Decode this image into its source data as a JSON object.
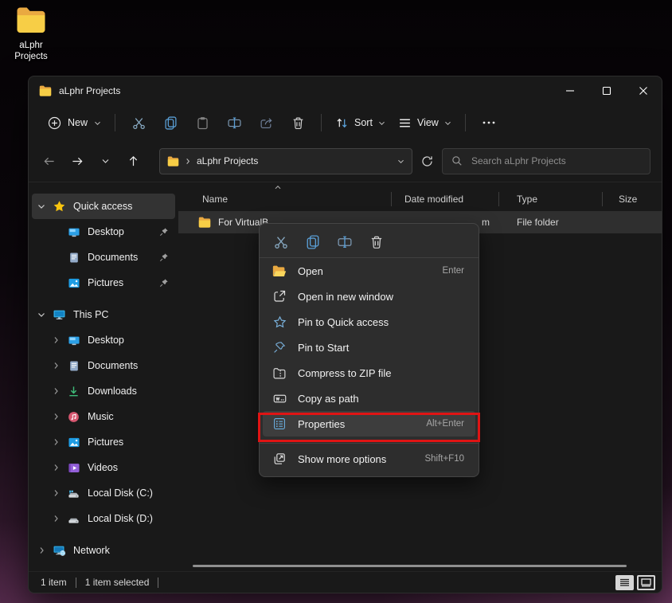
{
  "desktop_icon": {
    "label_line1": "aLphr",
    "label_line2": "Projects"
  },
  "window": {
    "title": "aLphr Projects"
  },
  "toolbar": {
    "new_label": "New",
    "sort_label": "Sort",
    "view_label": "View"
  },
  "address_bar": {
    "location": "aLphr Projects"
  },
  "search": {
    "placeholder": "Search aLphr Projects"
  },
  "sidebar": {
    "quick_access_label": "Quick access",
    "quick_access_items": [
      {
        "label": "Desktop",
        "pinned": true
      },
      {
        "label": "Documents",
        "pinned": true
      },
      {
        "label": "Pictures",
        "pinned": true
      }
    ],
    "this_pc_label": "This PC",
    "this_pc_items": [
      {
        "label": "Desktop"
      },
      {
        "label": "Documents"
      },
      {
        "label": "Downloads"
      },
      {
        "label": "Music"
      },
      {
        "label": "Pictures"
      },
      {
        "label": "Videos"
      },
      {
        "label": "Local Disk (C:)"
      },
      {
        "label": "Local Disk (D:)"
      }
    ],
    "network_label": "Network"
  },
  "content": {
    "columns": [
      {
        "label": "Name"
      },
      {
        "label": "Date modified"
      },
      {
        "label": "Type"
      },
      {
        "label": "Size"
      }
    ],
    "row": {
      "name": "For VirtualB",
      "date_visible_fragment": "m",
      "type": "File folder",
      "size": ""
    }
  },
  "context_menu": {
    "items": [
      {
        "label": "Open",
        "shortcut": "Enter"
      },
      {
        "label": "Open in new window",
        "shortcut": ""
      },
      {
        "label": "Pin to Quick access",
        "shortcut": ""
      },
      {
        "label": "Pin to Start",
        "shortcut": ""
      },
      {
        "label": "Compress to ZIP file",
        "shortcut": ""
      },
      {
        "label": "Copy as path",
        "shortcut": ""
      },
      {
        "label": "Properties",
        "shortcut": "Alt+Enter",
        "annotated": true
      },
      {
        "label": "Show more options",
        "shortcut": "Shift+F10"
      }
    ]
  },
  "status_bar": {
    "items_count": "1 item",
    "selection": "1 item selected"
  },
  "colors": {
    "accent_blue": "#5a9fd6",
    "folder_yellow": "#f7ce46",
    "annotation_red": "#df1414",
    "selection_bg": "#333333",
    "menu_bg": "#2d2d2d",
    "window_bg": "#191919"
  },
  "icons": {
    "folder-icon": "yellow two-tone folder",
    "search-icon": "magnifier",
    "refresh-icon": "circular arrow",
    "sort-icon": "up-down arrows",
    "view-icon": "three lines",
    "more-icon": "ellipsis",
    "pin-icon": "pushpin",
    "star-icon": "star"
  }
}
